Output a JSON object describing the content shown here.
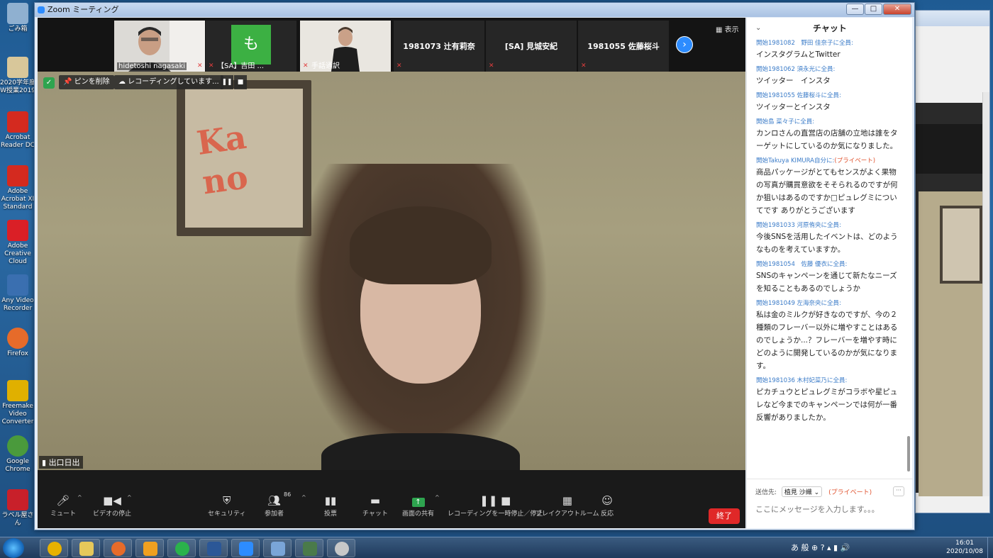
{
  "window": {
    "title": "Zoom ミーティング",
    "minimize": "—",
    "maximize": "□",
    "close": "✕"
  },
  "desktop_icons": [
    {
      "label": "ごみ箱",
      "color": "#8fb0d0"
    },
    {
      "label": "2020学年度W授業2019",
      "color": "#d8c79a"
    },
    {
      "label": "Acrobat Reader DC",
      "color": "#d42a1f"
    },
    {
      "label": "Adobe Acrobat XI Standard",
      "color": "#d42a1f"
    },
    {
      "label": "Adobe Creative Cloud",
      "color": "#da1f26"
    },
    {
      "label": "Any Video Recorder",
      "color": "#3a6fb0"
    },
    {
      "label": "Firefox",
      "color": "#e66b2a"
    },
    {
      "label": "Freemake Video Converter",
      "color": "#e0b000"
    },
    {
      "label": "Google Chrome",
      "color": "#4a9a3c"
    },
    {
      "label": "ラベル屋さん",
      "color": "#c8202a"
    }
  ],
  "gallery": {
    "tiles": [
      {
        "name": "hidetoshi nagasaki",
        "type": "video"
      },
      {
        "name": "【SA】吉田 ...",
        "type": "avatar",
        "avatar_char": "も",
        "avatar_color": "#3cb043"
      },
      {
        "name": "手話通訳",
        "type": "video"
      },
      {
        "name": "1981073 辻有莉奈",
        "type": "name"
      },
      {
        "name": "[SA] 見城安紀",
        "type": "name"
      },
      {
        "name": "1981055 佐藤桜斗",
        "type": "name"
      }
    ],
    "next_icon": "›",
    "view_label": "▦ 表示"
  },
  "main_video": {
    "unpin_label": "📌 ピンを削除",
    "recording_label": "☁ レコーディングしています...",
    "pause": "❚❚",
    "stop": "■",
    "speaker_name": "出口日出",
    "frame_logo": "Ka no"
  },
  "toolbar": {
    "mute": "ミュート",
    "video": "ビデオの停止",
    "security": "セキュリティ",
    "participants": "参加者",
    "participants_count": "86",
    "polls": "投票",
    "chat": "チャット",
    "share": "画面の共有",
    "recording": "レコーディングを一時停止／停止",
    "breakout": "ブレイクアウトルーム",
    "reactions": "反応",
    "end": "終了"
  },
  "chat": {
    "title": "チャット",
    "messages": [
      {
        "from": "開始1981082　野田 佳奈子に全員:",
        "private": "",
        "body": "インスタグラムとTwitter"
      },
      {
        "from": "開始1981062 須永光に全員:",
        "private": "",
        "body": "ツイッター　インスタ"
      },
      {
        "from": "開始1981055 佐藤桜斗に全員:",
        "private": "",
        "body": "ツイッターとインスタ"
      },
      {
        "from": "開始島 菜々子に全員:",
        "private": "",
        "body": "カンロさんの直営店の店舗の立地は誰をターゲットにしているのか気になりました。"
      },
      {
        "from": "開始Takuya KIMURA自分に:",
        "private": "(プライベート)",
        "body": "商品パッケージがとてもセンスがよく果物の写真が購買意欲をそそられるのですが何か狙いはあるのですか□ピュレグミについてです ありがとうございます"
      },
      {
        "from": "開始1981033 河原侑央に全員:",
        "private": "",
        "body": "今後SNSを活用したイベントは、どのようなものを考えていますか。"
      },
      {
        "from": "開始1981054　佐藤 優衣に全員:",
        "private": "",
        "body": "SNSのキャンペーンを通じて新たなニーズを知ることもあるのでしょうか"
      },
      {
        "from": "開始1981049 左海奈央に全員:",
        "private": "",
        "body": "私は金のミルクが好きなのですが、今の２種類のフレーバー以外に増やすことはあるのでしょうか...？フレーバーを増やす時にどのように開発しているのかが気になります。"
      },
      {
        "from": "開始1981036 木村妃菜乃に全員:",
        "private": "",
        "body": "ピカチュウとピュレグミがコラボや星ピュレなど今までのキャンペーンでは何が一番反響がありましたか。"
      }
    ],
    "send_to_label": "送信先:",
    "send_to_value": "植見 沙織 ⌄",
    "send_to_private": "(プライベート)",
    "more": "···",
    "input_placeholder": "ここにメッセージを入力します。。。"
  },
  "taskbar": {
    "apps": [
      {
        "name": "chrome",
        "color": "#e8b100"
      },
      {
        "name": "explorer",
        "color": "#e6c85a"
      },
      {
        "name": "firefox",
        "color": "#e66b2a"
      },
      {
        "name": "outlook",
        "color": "#f0a020"
      },
      {
        "name": "line",
        "color": "#2bb24c"
      },
      {
        "name": "word",
        "color": "#2b5797"
      },
      {
        "name": "zoom",
        "color": "#2d8cff"
      },
      {
        "name": "paint",
        "color": "#7aa5d8"
      },
      {
        "name": "screen-recorder",
        "color": "#4a7a4a"
      },
      {
        "name": "tool",
        "color": "#c8c8c8"
      }
    ],
    "tray_text": "あ 般 ⊕ ? ▴ ▮ 🔊",
    "time": "16:01",
    "date": "2020/10/08"
  }
}
